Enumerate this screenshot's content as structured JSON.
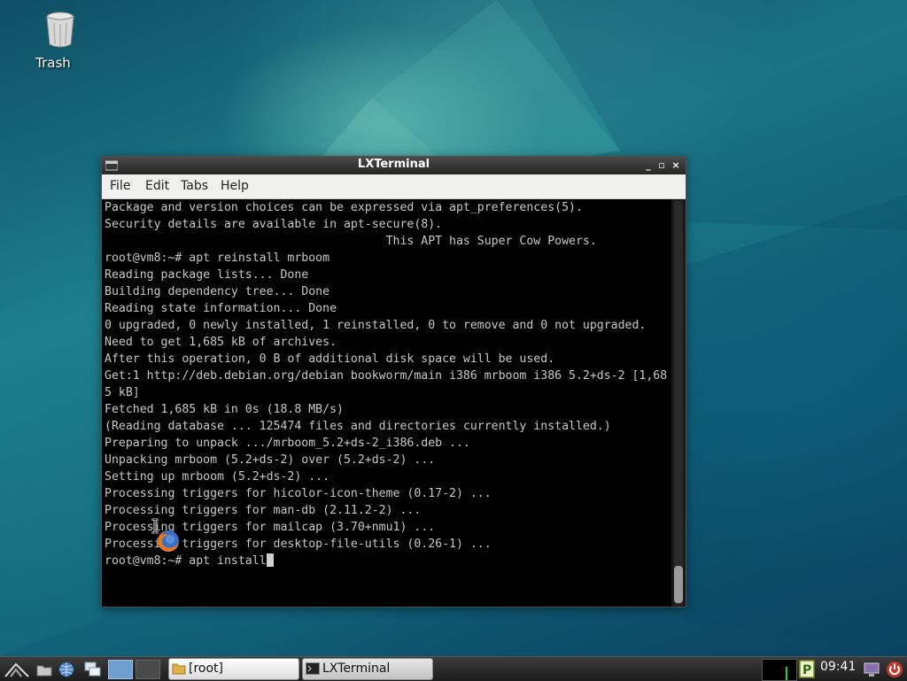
{
  "desktop": {
    "icons": [
      {
        "label": "Trash",
        "icon": "trash-icon"
      }
    ]
  },
  "window": {
    "title": "LXTerminal",
    "controls": {
      "minimize": "_",
      "maximize": "▫",
      "close": "×"
    },
    "menu": [
      "File",
      "Edit",
      "Tabs",
      "Help"
    ],
    "terminal": {
      "lines": [
        "Package and version choices can be expressed via apt_preferences(5).",
        "Security details are available in apt-secure(8).",
        "                                        This APT has Super Cow Powers.",
        "root@vm8:~# apt reinstall mrboom",
        "Reading package lists... Done",
        "Building dependency tree... Done",
        "Reading state information... Done",
        "0 upgraded, 0 newly installed, 1 reinstalled, 0 to remove and 0 not upgraded.",
        "Need to get 1,685 kB of archives.",
        "After this operation, 0 B of additional disk space will be used.",
        "Get:1 http://deb.debian.org/debian bookworm/main i386 mrboom i386 5.2+ds-2 [1,68",
        "5 kB]",
        "Fetched 1,685 kB in 0s (18.8 MB/s)",
        "(Reading database ... 125474 files and directories currently installed.)",
        "Preparing to unpack .../mrboom_5.2+ds-2_i386.deb ...",
        "Unpacking mrboom (5.2+ds-2) over (5.2+ds-2) ...",
        "Setting up mrboom (5.2+ds-2) ...",
        "Processing triggers for hicolor-icon-theme (0.17-2) ...",
        "Processing triggers for man-db (2.11.2-2) ...",
        "Processing triggers for mailcap (3.70+nmu1) ...",
        "Processing triggers for desktop-file-utils (0.26-1) ..."
      ],
      "prompt": "root@vm8:~# ",
      "current_input": "apt install"
    }
  },
  "taskbar": {
    "launchers": [
      "start-menu-icon",
      "file-manager-icon",
      "web-browser-icon",
      "show-desktop-icon",
      "workspace-1-icon",
      "workspace-2-icon"
    ],
    "tasks": [
      {
        "label": "[root]",
        "icon": "folder-icon",
        "active": true
      },
      {
        "label": "LXTerminal",
        "icon": "terminal-icon",
        "active": false
      }
    ],
    "tray": {
      "clock": "09:41"
    }
  },
  "colors": {
    "terminal_bg": "#000000",
    "terminal_fg": "#c8c8c8",
    "titlebar": "#2e2e2e",
    "menubar": "#f0f0ef",
    "taskbar": "#2a2a2a"
  }
}
